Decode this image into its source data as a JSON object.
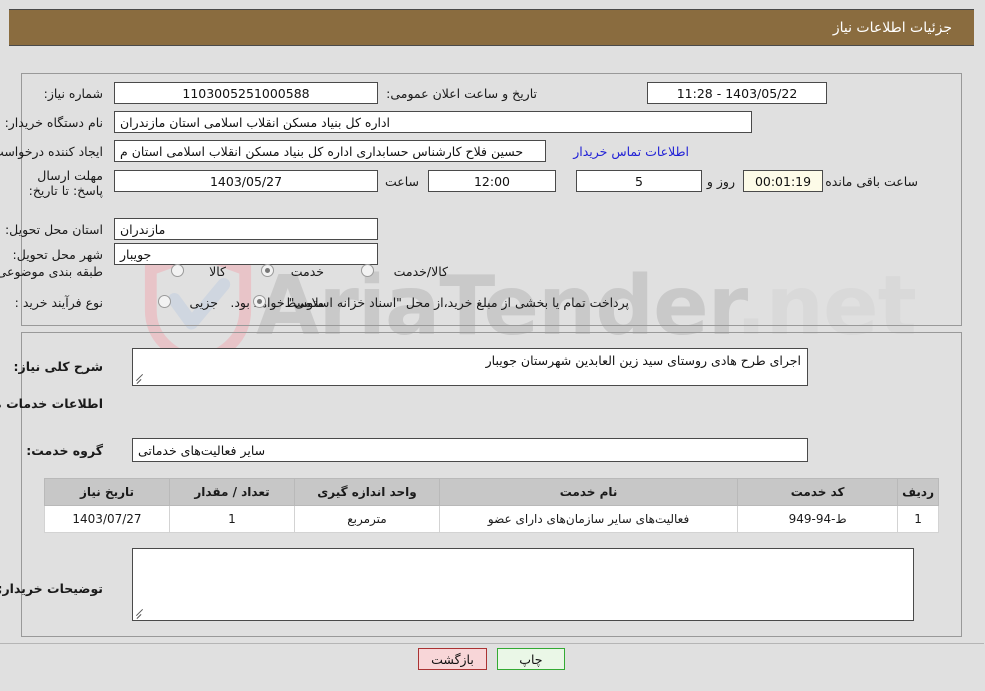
{
  "header": {
    "title": "جزئیات اطلاعات نیاز",
    "bg": "#8a6c3f"
  },
  "watermark": {
    "text": "AriaTender",
    "suffix": ".net"
  },
  "top_section": {
    "need_number_label": "شماره نیاز:",
    "need_number_value": "1103005251000588",
    "announce_label": "تاریخ و ساعت اعلان عمومی:",
    "announce_value": "1403/05/22 - 11:28",
    "buyer_org_label": "نام دستگاه خریدار:",
    "buyer_org_value": "اداره کل بنیاد مسکن انقلاب اسلامی استان مازندران",
    "creator_label": "ایجاد کننده درخواست:",
    "creator_value": "حسین فلاح کارشناس حسابداری اداره کل بنیاد مسکن انقلاب اسلامی استان م",
    "contact_link": "اطلاعات تماس خریدار",
    "deadline_label": "مهلت ارسال پاسخ: تا تاریخ:",
    "deadline_date": "1403/05/27",
    "hour_label": "ساعت",
    "deadline_time": "12:00",
    "days_value": "5",
    "days_label": "روز و",
    "countdown_value": "00:01:19",
    "remaining_label": "ساعت باقی مانده",
    "province_label": "استان محل تحویل:",
    "province_value": "مازندران",
    "city_label": "شهر محل تحویل:",
    "city_value": "جویبار",
    "category_label": "طبقه بندی موضوعی:",
    "category_options": [
      {
        "label": "کالا",
        "selected": false
      },
      {
        "label": "خدمت",
        "selected": true
      },
      {
        "label": "کالا/خدمت",
        "selected": false
      }
    ],
    "process_label": "نوع فرآیند خرید :",
    "process_options": [
      {
        "label": "جزیی",
        "selected": false
      },
      {
        "label": "متوسط",
        "selected": true
      }
    ],
    "payment_note": "پرداخت تمام یا بخشی از مبلغ خرید،از محل \"اسناد خزانه اسلامی\" خواهد بود."
  },
  "bottom_section": {
    "summary_label": "شرح کلی نیاز:",
    "summary_value": "اجرای طرح هادی روستای سید زین العابدین شهرستان جویبار",
    "services_heading": "اطلاعات خدمات مورد نیاز",
    "service_group_label": "گروه خدمت:",
    "service_group_value": "سایر فعالیت‌های خدماتی",
    "buyer_notes_label": "توضیحات خریدار;",
    "buyer_notes_value": ""
  },
  "table": {
    "columns": [
      "ردیف",
      "کد خدمت",
      "نام خدمت",
      "واحد اندازه گیری",
      "تعداد / مقدار",
      "تاریخ نیاز"
    ],
    "rows": [
      [
        "1",
        "ط-94-949",
        "فعالیت‌های سایر سازمان‌های دارای عضو",
        "مترمربع",
        "1",
        "1403/07/27"
      ]
    ]
  },
  "buttons": {
    "back": "بازگشت",
    "print": "چاپ"
  }
}
